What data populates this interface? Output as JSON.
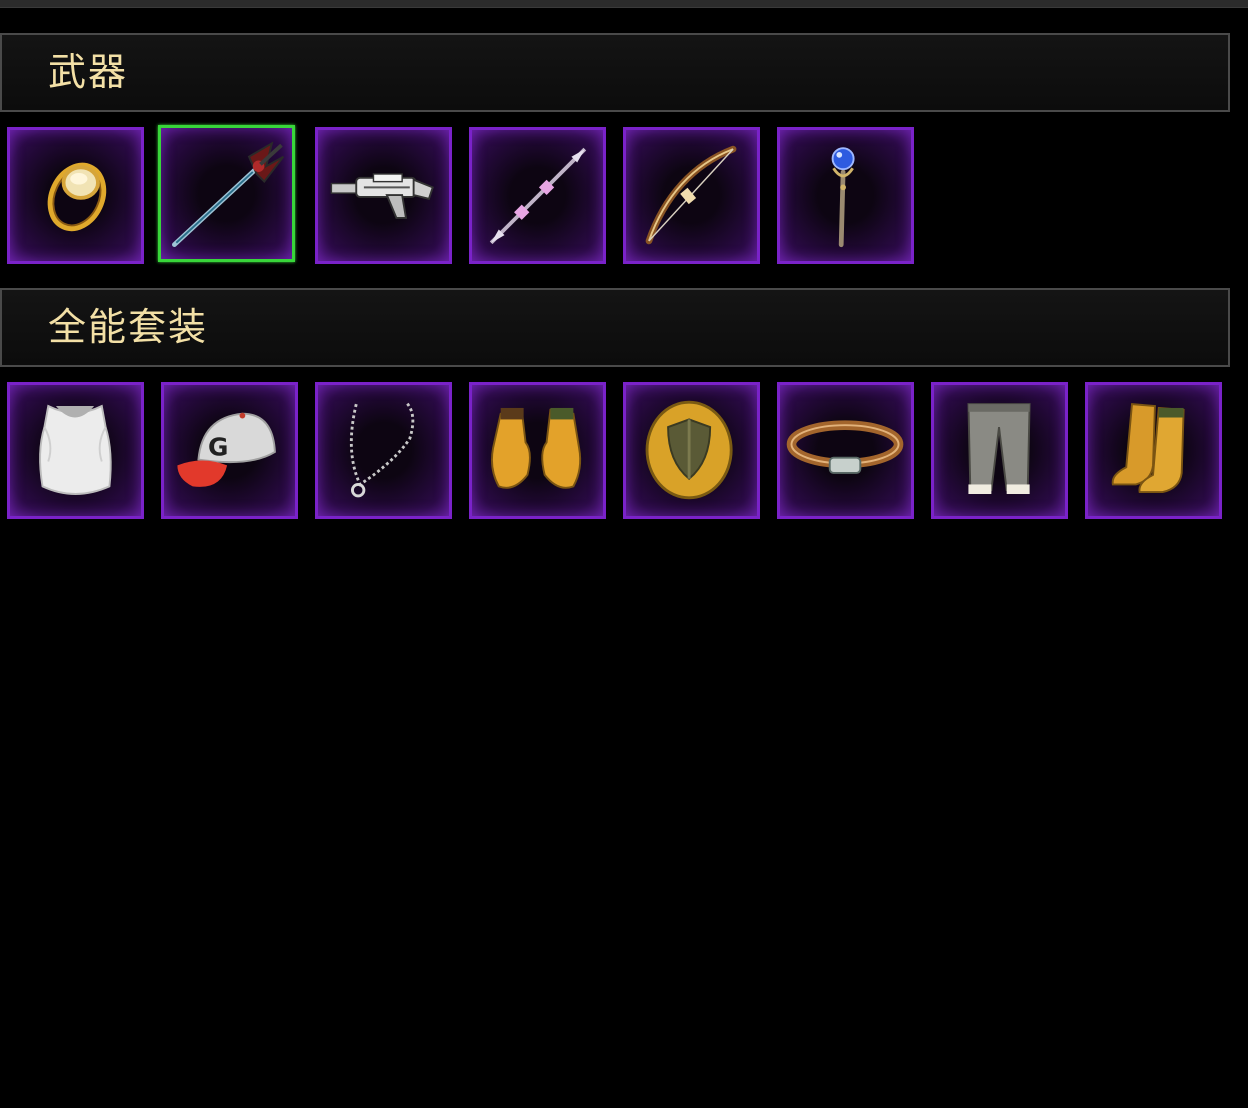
{
  "sections": [
    {
      "title": "武器",
      "items": [
        {
          "icon": "ring-icon",
          "selected": false
        },
        {
          "icon": "sword-icon",
          "selected": true
        },
        {
          "icon": "gun-icon",
          "selected": false
        },
        {
          "icon": "spear-icon",
          "selected": false
        },
        {
          "icon": "bow-icon",
          "selected": false
        },
        {
          "icon": "staff-icon",
          "selected": false
        }
      ]
    },
    {
      "title": "全能套装",
      "items": [
        {
          "icon": "vest-icon",
          "selected": false
        },
        {
          "icon": "cap-icon",
          "selected": false
        },
        {
          "icon": "necklace-icon",
          "selected": false
        },
        {
          "icon": "gloves-icon",
          "selected": false
        },
        {
          "icon": "shield-icon",
          "selected": false
        },
        {
          "icon": "belt-icon",
          "selected": false
        },
        {
          "icon": "pants-icon",
          "selected": false
        },
        {
          "icon": "boots-icon",
          "selected": false
        }
      ]
    }
  ],
  "colors": {
    "slot_border": "#7a22c9",
    "selected_border": "#38d63a",
    "title_text": "#f3e0a6"
  }
}
